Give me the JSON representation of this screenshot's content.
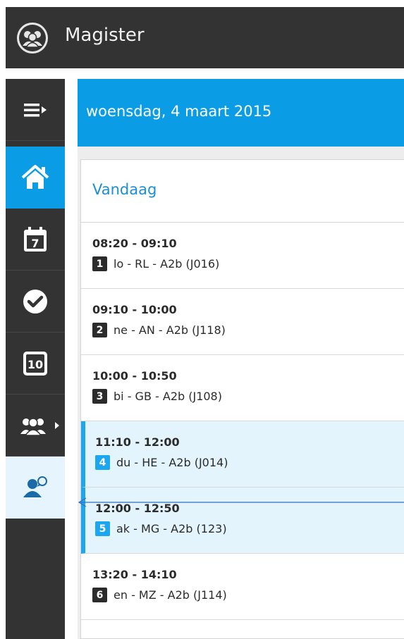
{
  "app": {
    "title": "Magister",
    "accent": "#0a9de6",
    "logo_icon": "users-circle-icon"
  },
  "sidebar": {
    "items": [
      {
        "name": "menu-toggle",
        "icon": "menu-expand-icon"
      },
      {
        "name": "home",
        "icon": "home-icon",
        "active": true
      },
      {
        "name": "agenda",
        "icon": "calendar-icon",
        "label": "7"
      },
      {
        "name": "tasks",
        "icon": "check-circle-icon"
      },
      {
        "name": "grades",
        "icon": "grade-icon",
        "label": "10"
      },
      {
        "name": "groups",
        "icon": "users-icon",
        "has_arrow": true
      },
      {
        "name": "contact",
        "icon": "user-chat-icon",
        "selected": true
      }
    ]
  },
  "header": {
    "date": "woensdag, 4 maart 2015"
  },
  "today": {
    "title": "Vandaag",
    "lessons": [
      {
        "time": "08:20 - 09:10",
        "num": "1",
        "desc": "lo - RL - A2b (J016)",
        "current": false
      },
      {
        "time": "09:10 - 10:00",
        "num": "2",
        "desc": "ne - AN - A2b (J118)",
        "current": false
      },
      {
        "time": "10:00 - 10:50",
        "num": "3",
        "desc": "bi - GB - A2b (J108)",
        "current": false
      },
      {
        "time": "11:10 - 12:00",
        "num": "4",
        "desc": "du - HE - A2b (J014)",
        "current": true
      },
      {
        "time": "12:00 - 12:50",
        "num": "5",
        "desc": "ak - MG - A2b (123)",
        "current": true
      },
      {
        "time": "13:20 - 14:10",
        "num": "6",
        "desc": "en - MZ - A2b (J114)",
        "current": false
      }
    ]
  }
}
